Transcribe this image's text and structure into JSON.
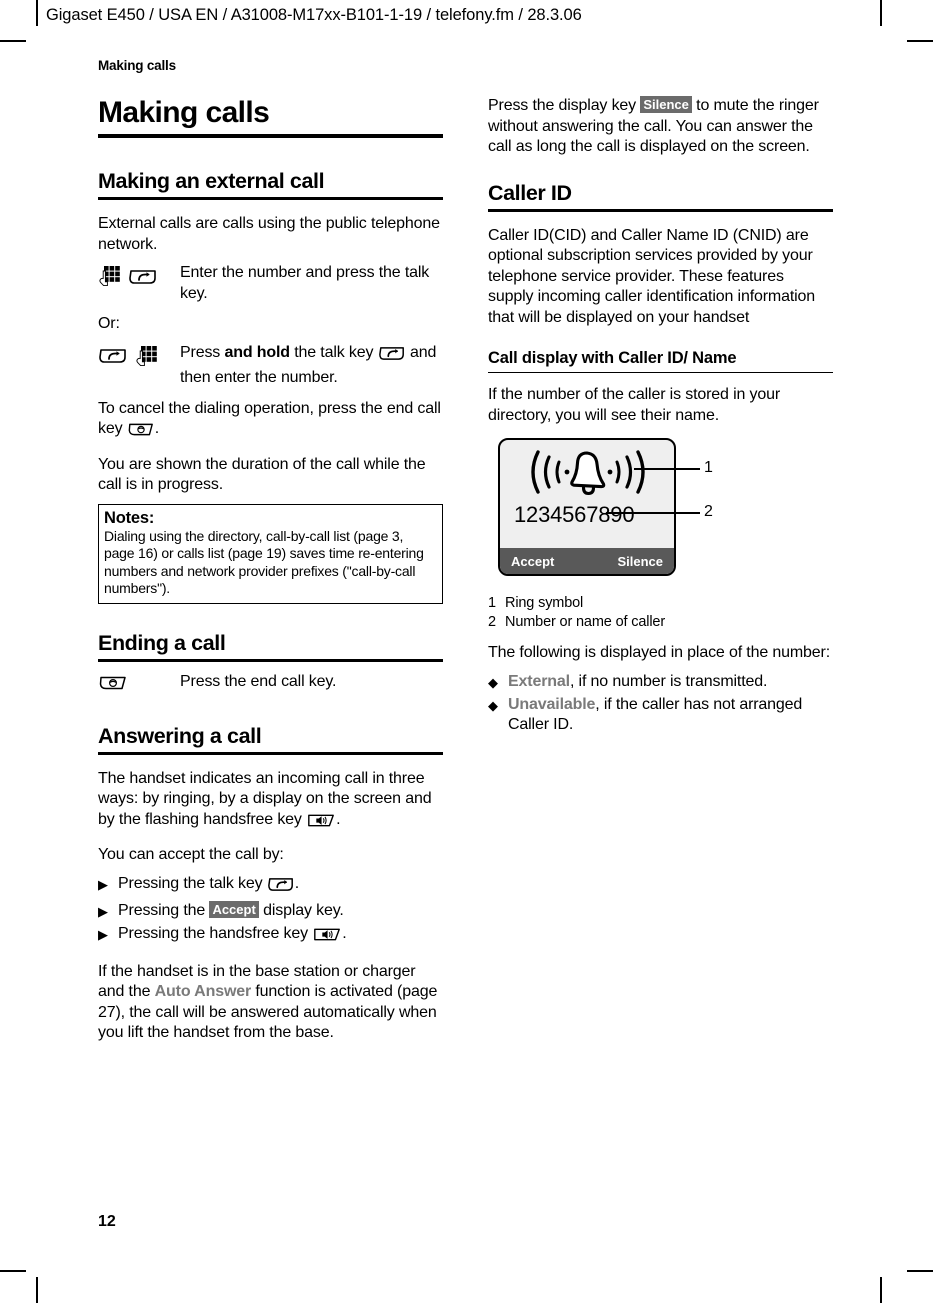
{
  "page": {
    "doc_header": "Gigaset E450 / USA EN / A31008-M17xx-B101-1-19 / telefony.fm / 28.3.06",
    "chapter_header": "Making calls",
    "page_number": "12"
  },
  "colors": {
    "ui_term": "#7a7a7a",
    "softkey_chip_bg": "#6b6b6b",
    "screen_bg": "#efefef",
    "softkey_bar_bg": "#595959",
    "rule": "#000000"
  },
  "left_column": {
    "title": "Making calls",
    "section_external": {
      "heading": "Making an external call",
      "intro": "External calls are calls using the public telephone network.",
      "step_1": {
        "icons": [
          "keypad-icon",
          "talk-key-icon"
        ],
        "text_before": "Enter the number and press the talk key."
      },
      "or_label": "Or:",
      "step_2": {
        "icons": [
          "talk-key-icon",
          "keypad-icon"
        ],
        "text_1": "Press ",
        "text_bold": "and hold",
        "text_2": " the talk key ",
        "text_3": " and then enter the number."
      },
      "cancel_1": "To cancel the dialing operation, press the end call key ",
      "cancel_2": ".",
      "duration": "You are shown the duration of the call while the call is in progress."
    },
    "notes": {
      "title": "Notes:",
      "body": "Dialing using the directory, call-by-call list (page 3, page 16) or calls list (page 19) saves time re-entering numbers and network provider prefixes (\"call-by-call numbers\")."
    },
    "section_ending": {
      "heading": "Ending a call",
      "step": {
        "icons": [
          "end-call-key-icon"
        ],
        "text": "Press the end call key."
      }
    },
    "section_answering": {
      "heading": "Answering a call",
      "intro_1": "The handset indicates an incoming call in three ways: by ringing, by a display on the screen and by the flashing handsfree key ",
      "intro_2": ".",
      "accept_lead": "You can accept the call by:",
      "items": [
        {
          "marker": "▶",
          "before": "Pressing the talk key ",
          "icon": "talk-key-icon",
          "after": "."
        },
        {
          "marker": "▶",
          "before": "Pressing the ",
          "chip": "Accept",
          "after": " display key."
        },
        {
          "marker": "▶",
          "before": "Pressing the handsfree key ",
          "icon": "handsfree-key-icon",
          "after": "."
        }
      ],
      "auto_answer_1": "If the handset is in the base station or charger and the ",
      "auto_answer_term": "Auto Answer",
      "auto_answer_2": " function is activated (page 27), the call will be answered automatically when you lift the handset from the base."
    }
  },
  "right_column": {
    "silence_para_1": "Press the display key ",
    "silence_chip": "Silence",
    "silence_para_2": " to mute the ringer without answering the call. You can answer the call as long the call is displayed on the screen.",
    "section_caller_id": {
      "heading": "Caller ID",
      "body": "Caller ID(CID) and Caller Name ID (CNID) are optional subscription services provided by your telephone service provider. These features supply incoming caller identification information that will be displayed on your handset"
    },
    "section_call_display": {
      "heading": "Call display with Caller ID/ Name",
      "intro": "If the number of the caller is stored in your directory, you will see their name."
    },
    "figure": {
      "ring_icon": "ring-symbol-icon",
      "caller_number": "1234567890",
      "softkey_left": "Accept",
      "softkey_right": "Silence",
      "callout_1": "1",
      "callout_2": "2"
    },
    "legend": [
      {
        "num": "1",
        "label": "Ring symbol"
      },
      {
        "num": "2",
        "label": "Number or name of caller"
      }
    ],
    "following_lead": "The following is displayed in place of the number:",
    "following_items": [
      {
        "marker": "◆",
        "term": "External",
        "rest": ", if no number is transmitted."
      },
      {
        "marker": "◆",
        "term": "Unavailable",
        "rest": ", if the caller has not arranged Caller ID."
      }
    ]
  }
}
